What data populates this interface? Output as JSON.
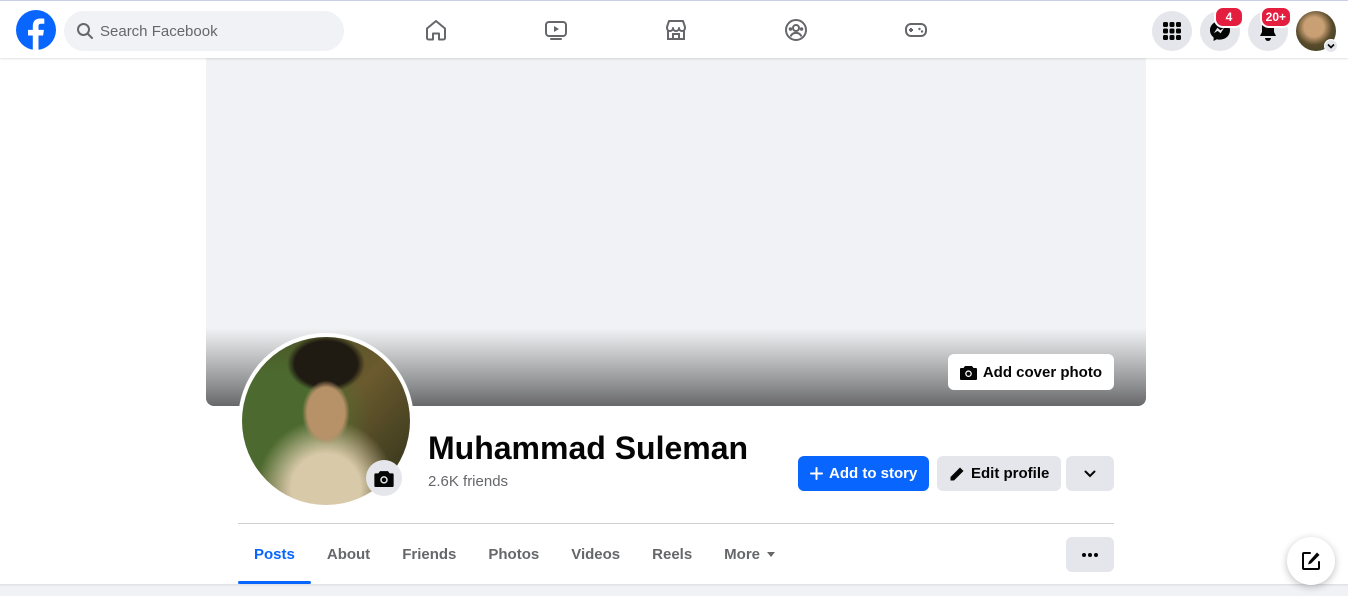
{
  "header": {
    "search_placeholder": "Search Facebook",
    "nav": [
      "home-icon",
      "watch-icon",
      "marketplace-icon",
      "groups-icon",
      "gaming-icon"
    ],
    "messenger_badge": "4",
    "notifications_badge": "20+"
  },
  "profile": {
    "name": "Muhammad Suleman",
    "friends": "2.6K friends",
    "add_cover_label": "Add cover photo",
    "add_story_label": "Add to story",
    "edit_profile_label": "Edit profile"
  },
  "tabs": [
    "Posts",
    "About",
    "Friends",
    "Photos",
    "Videos",
    "Reels",
    "More"
  ],
  "colors": {
    "accent": "#0866ff",
    "badge": "#e41e3f",
    "muted": "#65676b"
  }
}
